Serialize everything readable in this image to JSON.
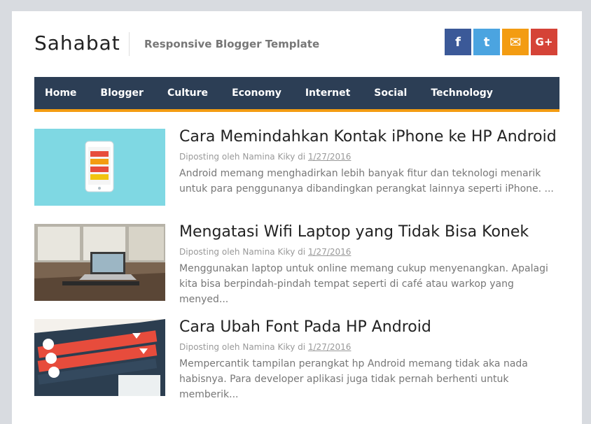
{
  "header": {
    "title": "Sahabat",
    "description": "Responsive Blogger Template"
  },
  "social": [
    {
      "name": "facebook-icon",
      "glyph": "f",
      "color": "#3b5998"
    },
    {
      "name": "twitter-icon",
      "glyph": "t",
      "color": "#4ba4e0"
    },
    {
      "name": "email-icon",
      "glyph": "✉",
      "color": "#f39c12"
    },
    {
      "name": "google-plus-icon",
      "glyph": "G+",
      "color": "#d54337"
    }
  ],
  "nav": {
    "bg": "#2c3e55",
    "accent": "#f39c12",
    "items": [
      "Home",
      "Blogger",
      "Culture",
      "Economy",
      "Internet",
      "Social",
      "Technology"
    ]
  },
  "posts": [
    {
      "title": "Cara Memindahkan Kontak iPhone ke HP Android",
      "meta_prefix": "Diposting oleh Namina Kiky di ",
      "date": "1/27/2016",
      "excerpt": "Android memang menghadirkan lebih banyak fitur dan teknologi menarik untuk para penggunanya dibandingkan perangkat lainnya seperti iPhone. ..."
    },
    {
      "title": "Mengatasi Wifi Laptop yang Tidak Bisa Konek",
      "meta_prefix": "Diposting oleh Namina Kiky di ",
      "date": "1/27/2016",
      "excerpt": "Menggunakan laptop untuk online memang cukup menyenangkan. Apalagi kita bisa berpindah-pindah tempat seperti di café atau warkop yang menyed..."
    },
    {
      "title": "Cara Ubah Font Pada HP Android",
      "meta_prefix": "Diposting oleh Namina Kiky di ",
      "date": "1/27/2016",
      "excerpt": "Mempercantik tampilan perangkat hp Android memang tidak aka nada habisnya. Para developer aplikasi juga tidak pernah berhenti untuk memberik..."
    }
  ]
}
